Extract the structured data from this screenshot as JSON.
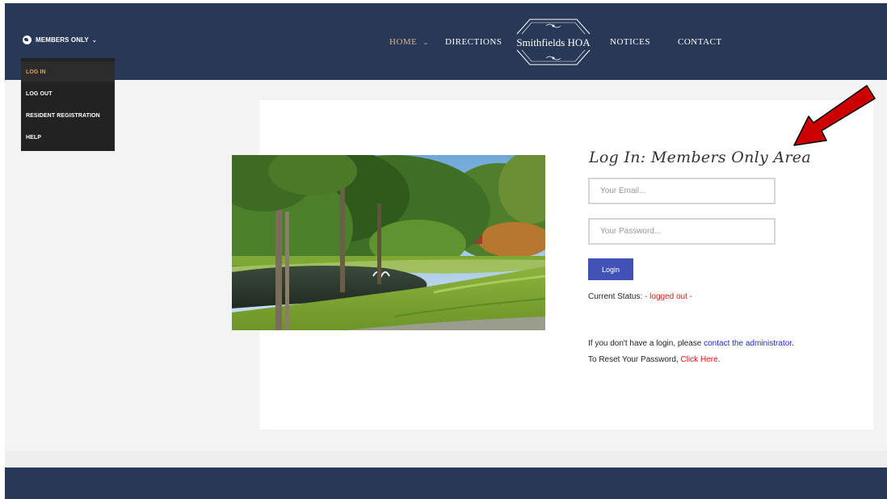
{
  "header": {
    "members_label": "MEMBERS ONLY",
    "logo_text": "Smithfields HOA",
    "nav": {
      "home": "HOME",
      "directions": "DIRECTIONS",
      "notices": "NOTICES",
      "contact": "CONTACT"
    }
  },
  "dropdown": {
    "items": [
      "LOG IN",
      "LOG OUT",
      "RESIDENT REGISTRATION",
      "HELP"
    ]
  },
  "login": {
    "title": "Log In: Members Only Area",
    "email_placeholder": "Your Email...",
    "password_placeholder": "Your Password...",
    "button_label": "Login",
    "status_label": "Current Status:",
    "status_value": "- logged out -",
    "no_login_text": "If you don't have a login, please",
    "contact_link": "contact the administrator",
    "period": ".",
    "reset_text": "To Reset Your Password,",
    "reset_link": "Click Here"
  },
  "colors": {
    "header_bg": "#283958",
    "nav_active": "#d9b38a",
    "button_bg": "#4052b5",
    "status_red": "#ee1111",
    "link_blue": "#1a2dc4",
    "arrow_red": "#cc0000"
  },
  "icons": {
    "members": "globe-icon",
    "dropdown": "chevron-down-icon",
    "annotation": "red-arrow-icon"
  }
}
